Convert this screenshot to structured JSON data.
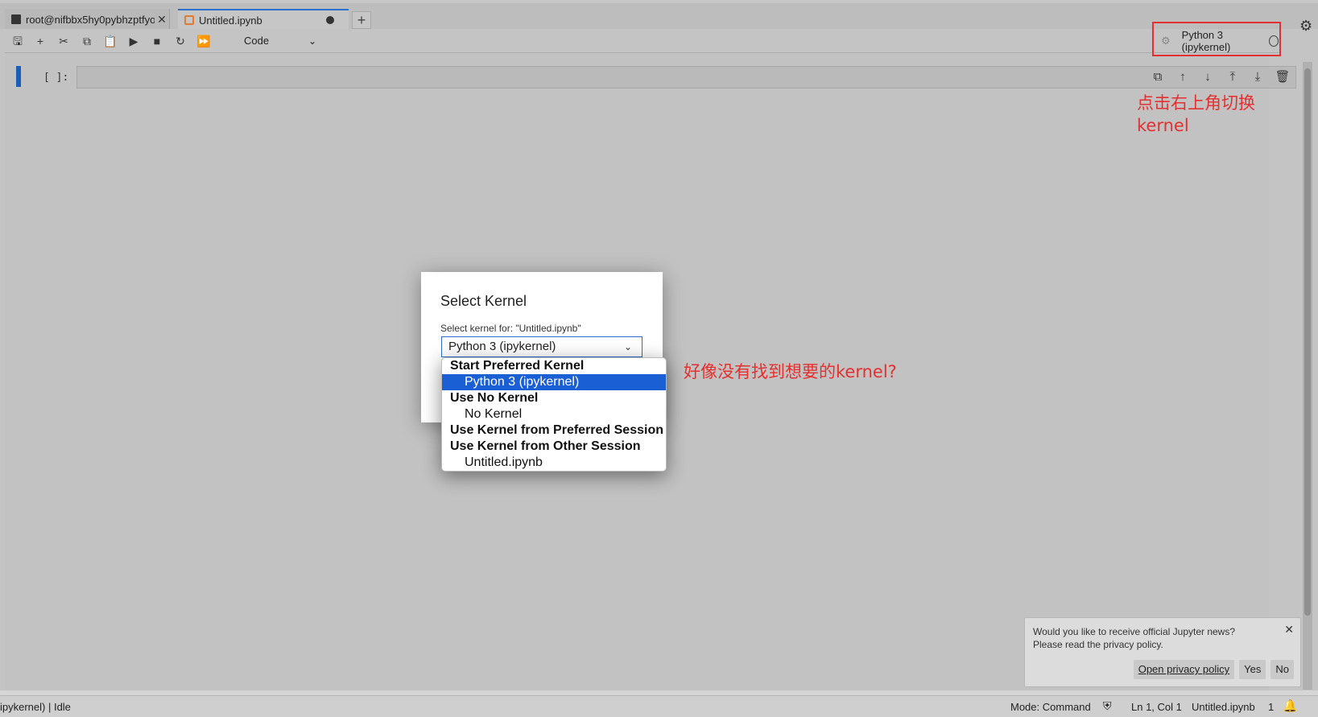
{
  "tabs": [
    {
      "label": "root@nifbbx5hy0pybhzptfyo",
      "close": "✕"
    },
    {
      "label": "Untitled.ipynb"
    }
  ],
  "new_tab": "+",
  "toolbar": {
    "icons": [
      "save-icon",
      "add-cell-icon",
      "cut-icon",
      "copy-icon",
      "paste-icon",
      "run-icon",
      "stop-icon",
      "restart-icon",
      "run-all-icon"
    ],
    "cell_type": "Code",
    "kernel_name": "Python 3 (ipykernel)"
  },
  "cell": {
    "prompt": "[ ]:"
  },
  "annotations": {
    "top_right": "点击右上角切换kernel",
    "dropdown": "好像没有找到想要的kernel?",
    "color": "#e53030"
  },
  "dialog": {
    "title": "Select Kernel",
    "subtitle": "Select kernel for: \"Untitled.ipynb\"",
    "selected": "Python 3 (ipykernel)",
    "options": [
      {
        "label": "Start Preferred Kernel",
        "kind": "group"
      },
      {
        "label": "Python 3 (ipykernel)",
        "kind": "option",
        "selected": true
      },
      {
        "label": "Use No Kernel",
        "kind": "group"
      },
      {
        "label": "No Kernel",
        "kind": "option"
      },
      {
        "label": "Use Kernel from Preferred Session",
        "kind": "group"
      },
      {
        "label": "Use Kernel from Other Session",
        "kind": "group"
      },
      {
        "label": "Untitled.ipynb",
        "kind": "option"
      }
    ]
  },
  "notification": {
    "message": "Would you like to receive official Jupyter news? Please read the privacy policy.",
    "open_policy": "Open privacy policy",
    "yes": "Yes",
    "no": "No"
  },
  "status": {
    "left": "ipykernel) | Idle",
    "mode": "Mode: Command",
    "position": "Ln 1, Col 1",
    "file": "Untitled.ipynb",
    "count": "1"
  }
}
